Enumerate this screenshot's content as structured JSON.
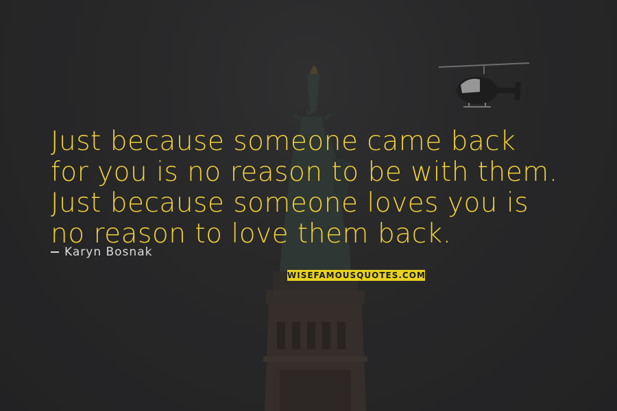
{
  "quote": {
    "lines": [
      "Just because someone came back",
      "for you is no reason to be with them.",
      "Just because someone loves you is",
      "no reason to love them back."
    ]
  },
  "author": {
    "name": "Karyn Bosnak"
  },
  "brand": {
    "text": "WISEFAMOUSQUOTES.COM",
    "color": "#e8d21f"
  },
  "colors": {
    "quote_text": "#f2d13a",
    "background": "#2b2b2d"
  }
}
